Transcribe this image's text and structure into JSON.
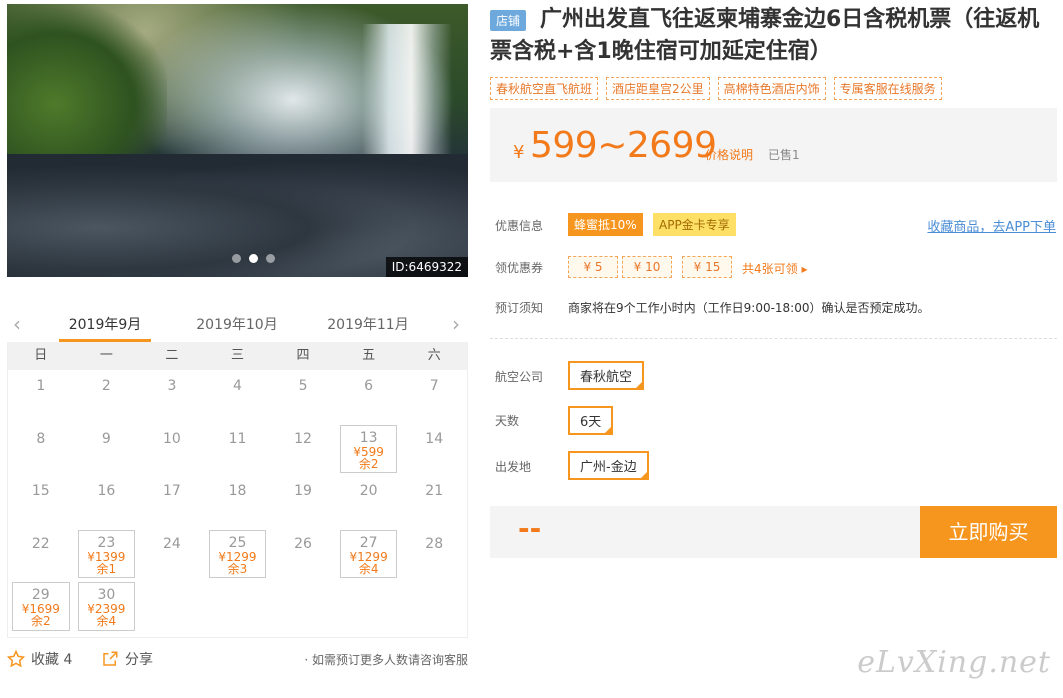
{
  "hero": {
    "image_id": "ID:6469322",
    "slides": 3,
    "active_slide": 1
  },
  "calendar": {
    "prev_label": "‹",
    "next_label": "›",
    "months": [
      "2019年9月",
      "2019年10月",
      "2019年11月"
    ],
    "weekdays": [
      "日",
      "一",
      "二",
      "三",
      "四",
      "五",
      "六"
    ],
    "days": [
      {
        "d": "1"
      },
      {
        "d": "2"
      },
      {
        "d": "3"
      },
      {
        "d": "4"
      },
      {
        "d": "5"
      },
      {
        "d": "6"
      },
      {
        "d": "7"
      },
      {
        "d": "8"
      },
      {
        "d": "9"
      },
      {
        "d": "10"
      },
      {
        "d": "11"
      },
      {
        "d": "12"
      },
      {
        "d": "13",
        "price": "¥599",
        "rem": "余2"
      },
      {
        "d": "14"
      },
      {
        "d": "15"
      },
      {
        "d": "16"
      },
      {
        "d": "17"
      },
      {
        "d": "18"
      },
      {
        "d": "19"
      },
      {
        "d": "20"
      },
      {
        "d": "21"
      },
      {
        "d": "22"
      },
      {
        "d": "23",
        "price": "¥1399",
        "rem": "余1"
      },
      {
        "d": "24"
      },
      {
        "d": "25",
        "price": "¥1299",
        "rem": "余3"
      },
      {
        "d": "26"
      },
      {
        "d": "27",
        "price": "¥1299",
        "rem": "余4"
      },
      {
        "d": "28"
      },
      {
        "d": "29",
        "price": "¥1699",
        "rem": "余2"
      },
      {
        "d": "30",
        "price": "¥2399",
        "rem": "余4"
      }
    ]
  },
  "actions": {
    "favorite": "收藏 4",
    "share": "分享",
    "note": "· 如需预订更多人数请咨询客服"
  },
  "product": {
    "shop_badge": "店铺",
    "title": "广州出发直飞往返柬埔寨金边6日含税机票（往返机票含税+含1晚住宿可加延定住宿）",
    "tags": [
      "春秋航空直飞航班",
      "酒店距皇宫2公里",
      "高棉特色酒店内饰",
      "专属客服在线服务"
    ],
    "price_yen": "¥",
    "price_range": "599~2699",
    "price_desc": "价格说明",
    "sold": "已售1"
  },
  "promo": {
    "label": "优惠信息",
    "badge1": "蜂蜜抵10%",
    "badge2": "APP金卡专享",
    "fav_link": "收藏商品，去APP下单"
  },
  "coupons": {
    "label": "领优惠券",
    "items": [
      "¥ 5",
      "¥ 10",
      "¥ 15"
    ],
    "more": "共4张可领 ▸"
  },
  "booking": {
    "label": "预订须知",
    "text": "商家将在9个工作小时内（工作日9:00-18:00）确认是否预定成功。"
  },
  "options": {
    "airline_label": "航空公司",
    "airline": "春秋航空",
    "days_label": "天数",
    "days": "6天",
    "depart_label": "出发地",
    "depart": "广州-金边"
  },
  "buy": {
    "total": "--",
    "button": "立即购买"
  },
  "watermark": "eLvXing.net",
  "colors": {
    "accent": "#f7961e",
    "price": "#f27a1a",
    "link": "#4b8ed6",
    "badge": "#6ea9de"
  }
}
